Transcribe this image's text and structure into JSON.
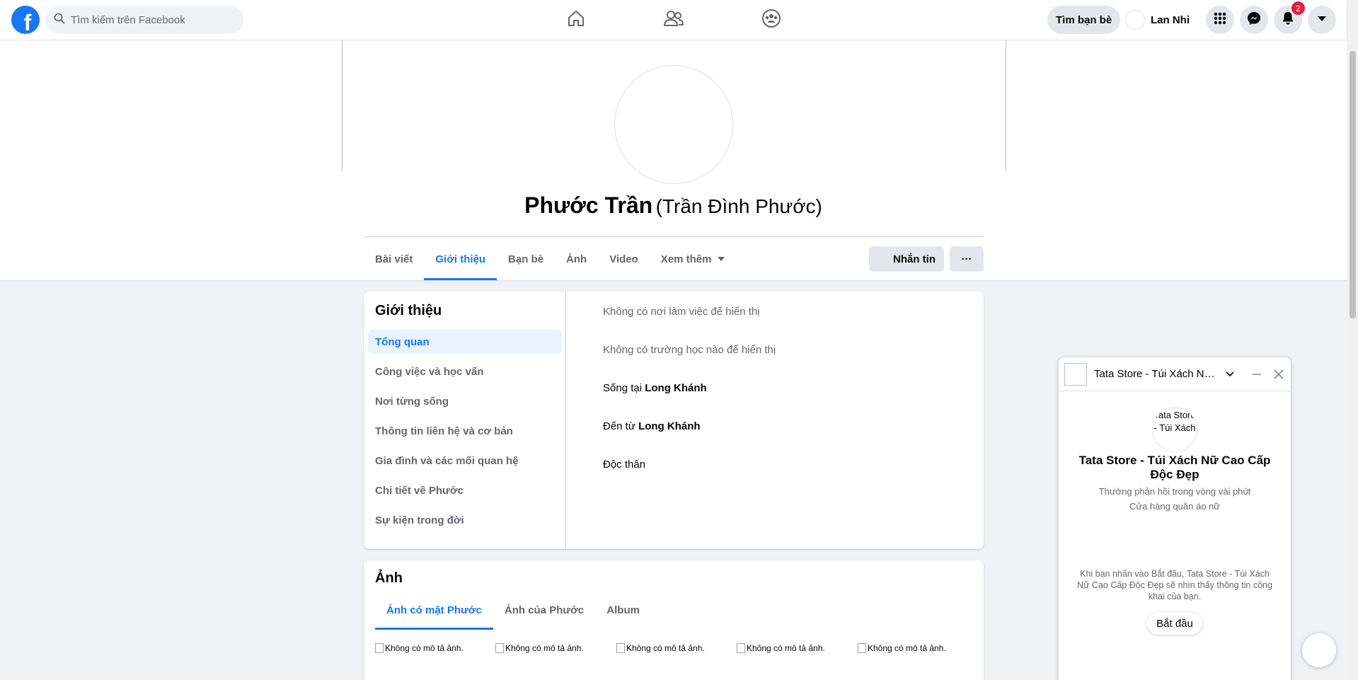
{
  "topbar": {
    "logo_letter": "f",
    "search_placeholder": "Tìm kiếm trên Facebook",
    "find_friends": "Tìm bạn bè",
    "user_name": "Lan Nhi",
    "notification_count": "2"
  },
  "profile": {
    "name": "Phước Trần",
    "alt_name": "(Trần Đình Phước)",
    "tabs": [
      "Bài viết",
      "Giới thiệu",
      "Bạn bè",
      "Ảnh",
      "Video",
      "Xem thêm"
    ],
    "message_button": "Nhắn tin",
    "more_button": "···"
  },
  "about": {
    "title": "Giới thiệu",
    "menu": [
      "Tổng quan",
      "Công việc và học vấn",
      "Nơi từng sống",
      "Thông tin liên hệ và cơ bản",
      "Gia đình và các mối quan hệ",
      "Chi tiết về Phước",
      "Sự kiện trong đời"
    ],
    "work": "Không có nơi làm việc để hiển thị",
    "school": "Không có trường học nào để hiển thị",
    "lives_prefix": "Sống tại ",
    "lives_place": "Long Khánh",
    "from_prefix": "Đến từ ",
    "from_place": "Long Khánh",
    "relationship": "Độc thân"
  },
  "photos": {
    "title": "Ảnh",
    "tabs": [
      "Ảnh có mặt Phước",
      "Ảnh của Phước",
      "Album"
    ],
    "alt_text": "Không có mô tả ảnh."
  },
  "chat": {
    "title": "Tata Store - Túi Xách Nữ Cao Cấp Độc Đẹp",
    "avatar_alt": "Tata Store - Túi Xách",
    "name": "Tata Store - Túi Xách Nữ Cao Cấp Độc Đẹp",
    "response_time": "Thường phản hồi trong vòng vài phút",
    "category": "Cửa hàng quần áo nữ",
    "notice": "Khi bạn nhấn vào Bắt đầu, Tata Store - Túi Xách Nữ Cao Cấp Độc Đẹp sẽ nhìn thấy thông tin công khai của bạn.",
    "start_button": "Bắt đầu"
  },
  "colors": {
    "brand": "#1877f2",
    "badge": "#e41e3f"
  }
}
